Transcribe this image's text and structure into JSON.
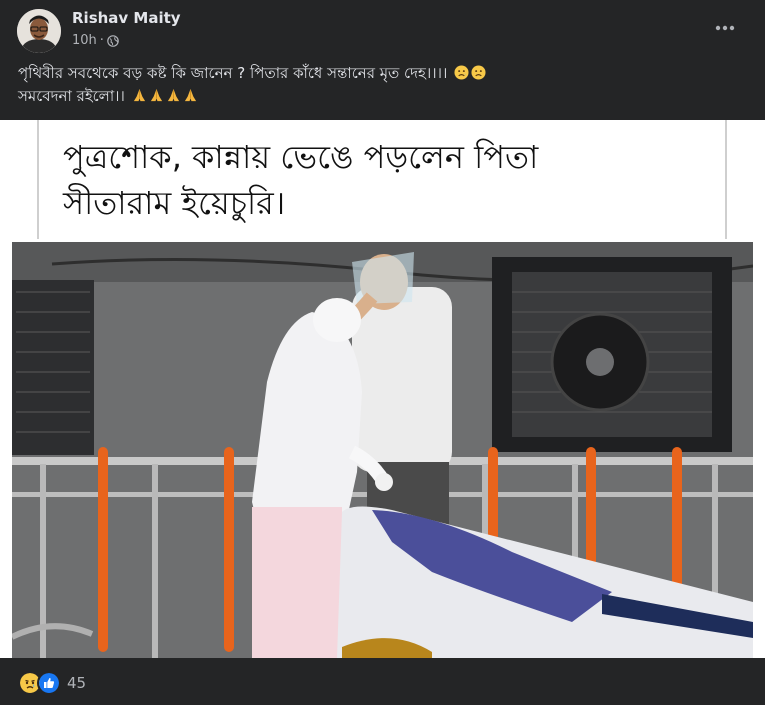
{
  "post": {
    "author": "Rishav Maity",
    "timestamp": "10h",
    "separator": "·",
    "privacy_icon": "globe-icon",
    "more_icon": "more-horizontal-icon",
    "text_line1": "পৃথিবীর সবথেকে বড় কষ্ট কি জানেন ? পিতার কাঁধে সন্তানের মৃত দেহ।।।।",
    "text_line2": "সমবেদনা রইলো।।",
    "line1_emojis": [
      "sad-face-icon",
      "sad-face-icon"
    ],
    "line2_emojis": [
      "folded-hands-icon",
      "folded-hands-icon",
      "folded-hands-icon",
      "folded-hands-icon"
    ]
  },
  "media": {
    "headline_line1": "পুত্রশোক, কান্নায় ভেঙে পড়লেন পিতা",
    "headline_line2": "সীতারাম ইয়েচুরি।"
  },
  "footer": {
    "reactions": [
      "sad-reaction-icon",
      "like-reaction-icon"
    ],
    "reaction_count": "45"
  },
  "colors": {
    "background": "#242526",
    "text_primary": "#e4e6eb",
    "text_secondary": "#b0b3b8",
    "like_blue": "#1877f2",
    "sad_yellow": "#f7c948"
  }
}
